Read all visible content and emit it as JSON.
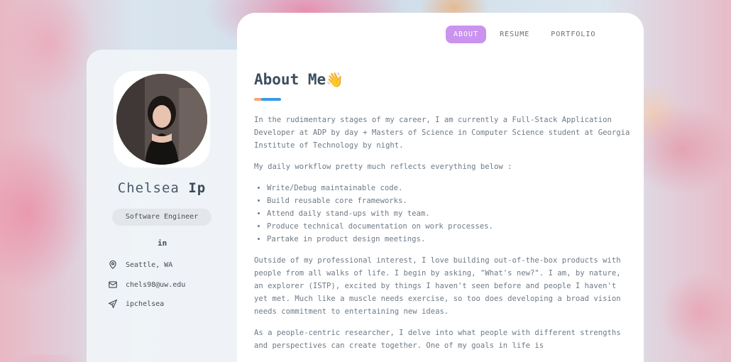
{
  "nav": {
    "tabs": [
      {
        "label": "ABOUT",
        "active": true
      },
      {
        "label": "RESUME",
        "active": false
      },
      {
        "label": "PORTFOLIO",
        "active": false
      }
    ]
  },
  "profile": {
    "first_name": "Chelsea",
    "last_name": "Ip",
    "role": "Software Engineer",
    "social_icon": "linkedin-icon",
    "social_label": "in",
    "location": "Seattle, WA",
    "email": "chels98@uw.edu",
    "handle": "ipchelsea"
  },
  "about": {
    "title": "About Me",
    "title_emoji": "👋",
    "intro": "In the rudimentary stages of my career, I am currently a Full-Stack Application Developer at ADP by day + Masters of Science in Computer Science student at Georgia Institute of Technology by night.",
    "workflow_intro": "My daily workflow pretty much reflects everything below :",
    "workflow_items": [
      "Write/Debug maintainable code.",
      "Build reusable core frameworks.",
      "Attend daily stand-ups with my team.",
      "Produce technical documentation on work processes.",
      "Partake in product design meetings."
    ],
    "interest": "Outside of my professional interest, I love building out-of-the-box products with people from all walks of life. I begin by asking, \"What's new?\". I am, by nature, an explorer (ISTP), excited by things I haven't seen before and people I haven't yet met. Much like a muscle needs exercise, so too does developing a broad vision needs commitment to entertaining new ideas.",
    "researcher": "As a people-centric researcher, I delve into what people with different strengths and perspectives can create together. One of my goals in life is"
  },
  "colors": {
    "accent_purple": "#c993ef",
    "underline_orange": "#f5a67a",
    "underline_blue": "#3a9be6",
    "heading": "#3d4d5e",
    "body_text": "#6e7a86"
  }
}
